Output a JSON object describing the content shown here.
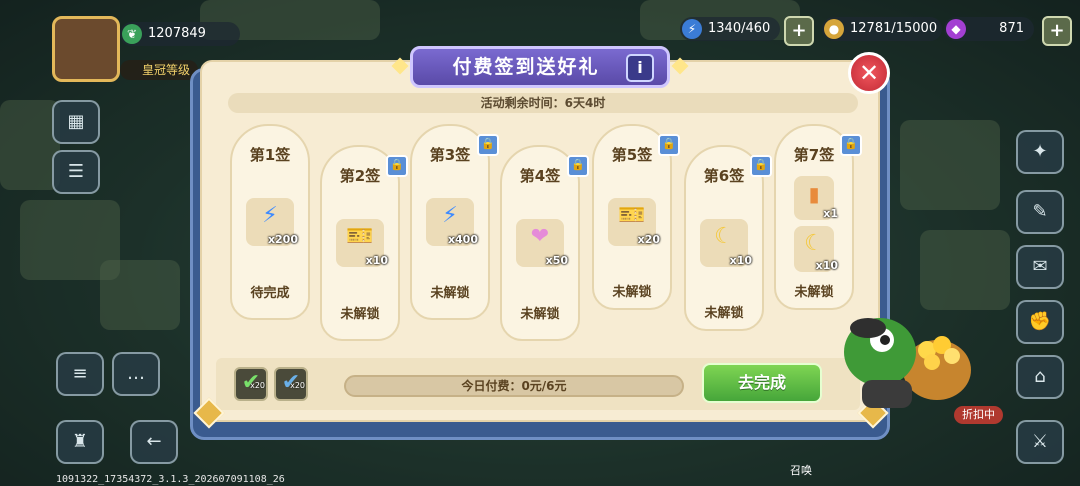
{
  "hud": {
    "score": "1207849",
    "vip_label": "皇冠等级",
    "energy": "1340/460",
    "coins": "12781/15000",
    "gems": "871"
  },
  "panel": {
    "title": "付费签到送好礼",
    "time_left": "活动剩余时间：6天4时",
    "cards": [
      {
        "day": "第1签",
        "rewards": [
          {
            "icon": "lightning-icon",
            "count": "x200"
          }
        ],
        "status": "待完成",
        "locked": false
      },
      {
        "day": "第2签",
        "rewards": [
          {
            "icon": "ticket-icon",
            "count": "x10"
          }
        ],
        "status": "未解锁",
        "locked": true
      },
      {
        "day": "第3签",
        "rewards": [
          {
            "icon": "lightning-icon",
            "count": "x400"
          }
        ],
        "status": "未解锁",
        "locked": true
      },
      {
        "day": "第4签",
        "rewards": [
          {
            "icon": "rainbow-gem-icon",
            "count": "x50"
          }
        ],
        "status": "未解锁",
        "locked": true
      },
      {
        "day": "第5签",
        "rewards": [
          {
            "icon": "ticket-icon",
            "count": "x20"
          }
        ],
        "status": "未解锁",
        "locked": true
      },
      {
        "day": "第6签",
        "rewards": [
          {
            "icon": "moon-icon",
            "count": "x10"
          }
        ],
        "status": "未解锁",
        "locked": true
      },
      {
        "day": "第7签",
        "rewards": [
          {
            "icon": "card-icon",
            "count": "x1"
          },
          {
            "icon": "moon-icon",
            "count": "x10"
          }
        ],
        "status": "未解锁",
        "locked": true
      }
    ],
    "checks": [
      {
        "count": "x20"
      },
      {
        "count": "x20"
      }
    ],
    "progress_text": "今日付费：0元/6元",
    "progress_fraction": 0,
    "go_button": "去完成"
  },
  "side": {
    "discount_label": "折扣中",
    "summon_label": "召唤"
  },
  "footer": {
    "build_id": "1091322_17354372_3.1.3_202607091108_26"
  }
}
